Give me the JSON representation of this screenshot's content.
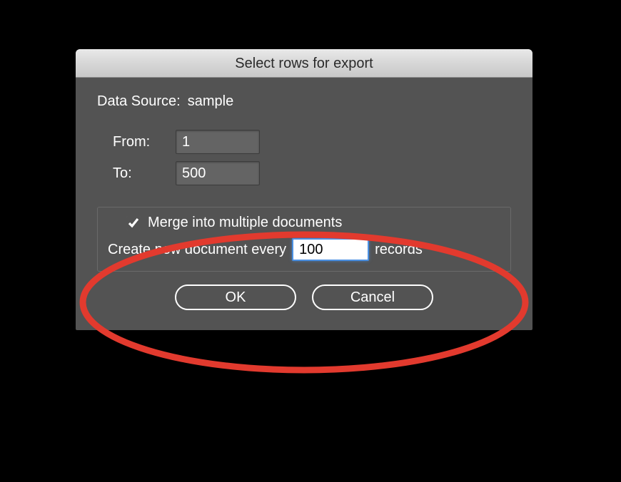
{
  "dialog": {
    "title": "Select rows for export",
    "dataSourceLabel": "Data Source:",
    "dataSourceValue": "sample",
    "fromLabel": "From:",
    "fromValue": "1",
    "toLabel": "To:",
    "toValue": "500",
    "mergeCheckboxLabel": "Merge into multiple documents",
    "mergeChecked": true,
    "createPrefix": "Create new document every",
    "createValue": "100",
    "createSuffix": "records",
    "okLabel": "OK",
    "cancelLabel": "Cancel"
  }
}
